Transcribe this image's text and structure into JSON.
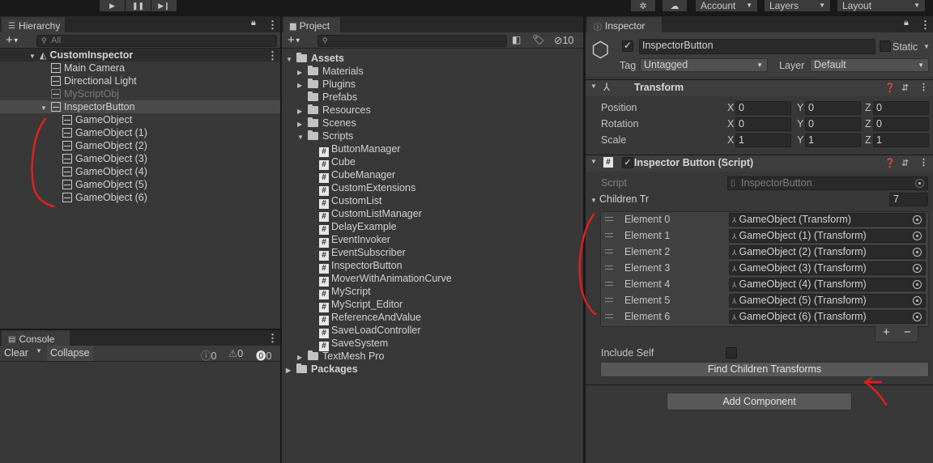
{
  "topbar": {
    "play_icon": "play-icon",
    "pause_icon": "pause-icon",
    "step_icon": "step-icon",
    "account": "Account",
    "layers": "Layers",
    "layout": "Layout"
  },
  "hierarchy": {
    "tab": "Hierarchy",
    "search_placeholder": "All",
    "scene": "CustomInspector",
    "items": [
      "Main Camera",
      "Directional Light",
      "MyScriptObj",
      "InspectorButton"
    ],
    "children": [
      "GameObject",
      "GameObject (1)",
      "GameObject (2)",
      "GameObject (3)",
      "GameObject (4)",
      "GameObject (5)",
      "GameObject (6)"
    ]
  },
  "console": {
    "tab": "Console",
    "clear": "Clear",
    "collapse": "Collapse",
    "counts": [
      "0",
      "0",
      "0"
    ]
  },
  "project": {
    "tab": "Project",
    "hidden_count": "10",
    "assets": "Assets",
    "folders": [
      "Materials",
      "Plugins",
      "Prefabs",
      "Resources",
      "Scenes",
      "Scripts"
    ],
    "scripts": [
      "ButtonManager",
      "Cube",
      "CubeManager",
      "CustomExtensions",
      "CustomList",
      "CustomListManager",
      "DelayExample",
      "EventInvoker",
      "EventSubscriber",
      "InspectorButton",
      "MoverWithAnimationCurve",
      "MyScript",
      "MyScript_Editor",
      "ReferenceAndValue",
      "SaveLoadController",
      "SaveSystem"
    ],
    "after": [
      "TextMesh Pro"
    ],
    "packages": "Packages"
  },
  "inspector": {
    "tab": "Inspector",
    "object_name": "InspectorButton",
    "static": "Static",
    "tag_label": "Tag",
    "tag": "Untagged",
    "layer_label": "Layer",
    "layer": "Default",
    "transform": {
      "title": "Transform",
      "rows": [
        {
          "label": "Position",
          "x": "0",
          "y": "0",
          "z": "0"
        },
        {
          "label": "Rotation",
          "x": "0",
          "y": "0",
          "z": "0"
        },
        {
          "label": "Scale",
          "x": "1",
          "y": "1",
          "z": "1"
        }
      ],
      "axes": [
        "X",
        "Y",
        "Z"
      ]
    },
    "script_comp": {
      "title": "Inspector Button (Script)",
      "script_label": "Script",
      "script_value": "InspectorButton",
      "list_label": "Children Tr",
      "list_size": "7",
      "elements": [
        {
          "label": "Element 0",
          "value": "GameObject (Transform)"
        },
        {
          "label": "Element 1",
          "value": "GameObject (1) (Transform)"
        },
        {
          "label": "Element 2",
          "value": "GameObject (2) (Transform)"
        },
        {
          "label": "Element 3",
          "value": "GameObject (3) (Transform)"
        },
        {
          "label": "Element 4",
          "value": "GameObject (4) (Transform)"
        },
        {
          "label": "Element 5",
          "value": "GameObject (5) (Transform)"
        },
        {
          "label": "Element 6",
          "value": "GameObject (6) (Transform)"
        }
      ],
      "include_self": "Include Self",
      "find_button": "Find Children Transforms"
    },
    "add_component": "Add Component"
  },
  "annotation_color": "#e02020"
}
